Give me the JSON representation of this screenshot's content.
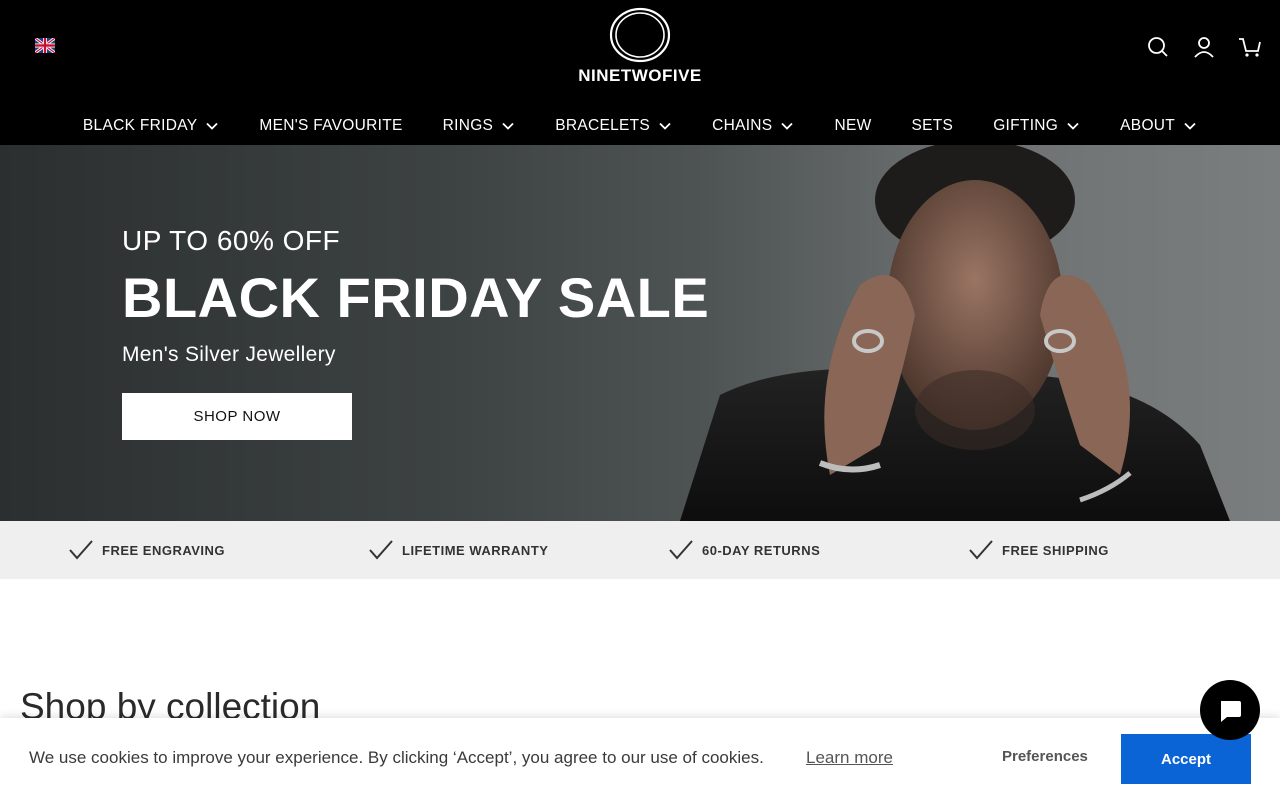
{
  "header": {
    "language_icon": "uk-flag-icon",
    "logo_text": "NINETWOFIVE",
    "icons": [
      "search-icon",
      "account-icon",
      "cart-icon"
    ]
  },
  "nav": {
    "items": [
      {
        "label": "BLACK FRIDAY",
        "has_dropdown": true
      },
      {
        "label": "MEN'S FAVOURITE",
        "has_dropdown": false
      },
      {
        "label": "RINGS",
        "has_dropdown": true
      },
      {
        "label": "BRACELETS",
        "has_dropdown": true
      },
      {
        "label": "CHAINS",
        "has_dropdown": true
      },
      {
        "label": "NEW",
        "has_dropdown": false
      },
      {
        "label": "SETS",
        "has_dropdown": false
      },
      {
        "label": "GIFTING",
        "has_dropdown": true
      },
      {
        "label": "ABOUT",
        "has_dropdown": true
      }
    ]
  },
  "hero": {
    "subtitle": "UP TO 60% OFF",
    "title": "BLACK FRIDAY SALE",
    "tagline": "Men's Silver Jewellery",
    "button_label": "SHOP NOW"
  },
  "usp": {
    "items": [
      {
        "label": "FREE ENGRAVING",
        "icon": "check-icon"
      },
      {
        "label": "LIFETIME WARRANTY",
        "icon": "check-icon"
      },
      {
        "label": "60-DAY RETURNS",
        "icon": "check-icon"
      },
      {
        "label": "FREE SHIPPING",
        "icon": "check-icon"
      }
    ]
  },
  "section": {
    "title": "Shop by collection"
  },
  "cookie": {
    "message": "We use cookies to improve your experience. By clicking ‘Accept’, you agree to our use of cookies.",
    "learn_more": "Learn more",
    "preferences": "Preferences",
    "accept": "Accept"
  },
  "colors": {
    "header_bg": "#000000",
    "accept_button": "#0a64d6",
    "usp_bg": "#efefef"
  }
}
